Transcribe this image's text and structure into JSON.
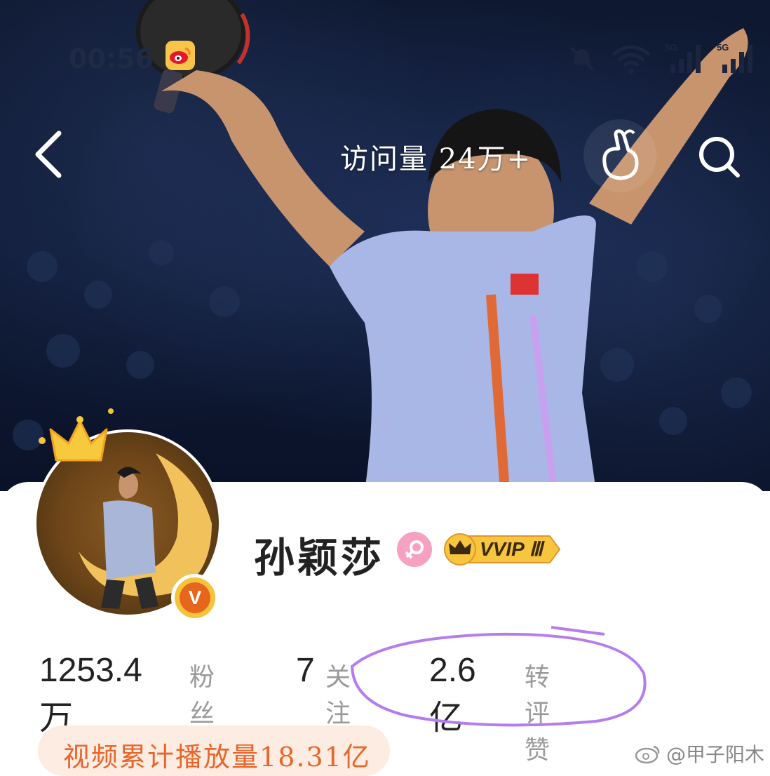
{
  "status_bar": {
    "time": "00:56"
  },
  "nav": {
    "visits_label": "访问量",
    "visits_value": "24万+"
  },
  "profile": {
    "name": "孙颖莎",
    "vvip_label": "VVIP",
    "vvip_level": "Ⅲ",
    "verified_mark": "V"
  },
  "stats": {
    "fans_value": "1253.4万",
    "fans_label": "粉丝",
    "follow_value": "7",
    "follow_label": "关注",
    "likes_value": "2.6亿",
    "likes_label": "转评赞"
  },
  "video": {
    "label": "视频累计播放量",
    "value": "18.31亿"
  },
  "watermark": {
    "text": "@甲子阳木"
  },
  "colors": {
    "accent_orange": "#e9652a",
    "anno_purple": "#b57cf0",
    "vvip_gold": "#f5c33c"
  },
  "icons": [
    "back-arrow-icon",
    "finger-heart-icon",
    "search-icon",
    "weibo-icon",
    "mute-icon",
    "wifi-icon",
    "signal-icon",
    "gender-female-icon",
    "crown-icon",
    "verified-icon"
  ]
}
